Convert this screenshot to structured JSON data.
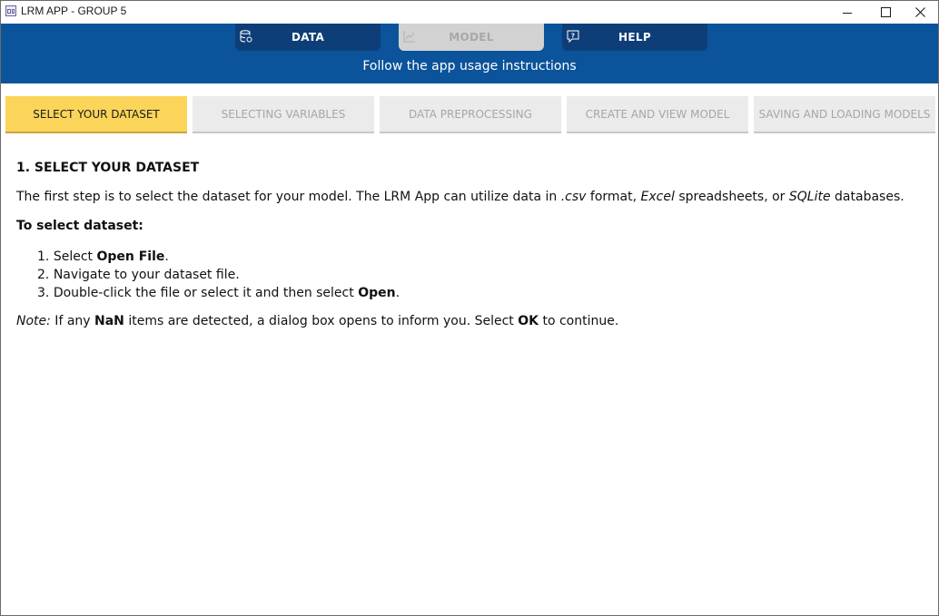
{
  "window": {
    "title": "LRM APP - GROUP 5",
    "controls": [
      "minimize",
      "maximize",
      "close"
    ]
  },
  "nav": {
    "tabs": [
      {
        "label": "DATA",
        "icon": "database-icon",
        "state": "enabled"
      },
      {
        "label": "MODEL",
        "icon": "chart-icon",
        "state": "disabled"
      },
      {
        "label": "HELP",
        "icon": "help-chat-icon",
        "state": "enabled"
      }
    ],
    "subtitle": "Follow the app usage instructions"
  },
  "steps": [
    {
      "label": "SELECT YOUR DATASET",
      "active": true
    },
    {
      "label": "SELECTING VARIABLES",
      "active": false
    },
    {
      "label": "DATA PREPROCESSING",
      "active": false
    },
    {
      "label": "CREATE AND VIEW MODEL",
      "active": false
    },
    {
      "label": "SAVING AND LOADING MODELS",
      "active": false
    }
  ],
  "content": {
    "heading": "1. SELECT YOUR DATASET",
    "intro": {
      "part1": "The first step is to select the dataset for your model. The LRM App can utilize data in ",
      "csv": ".csv",
      "part2": " format, ",
      "excel": "Excel",
      "part3": " spreadsheets, or ",
      "sqlite": "SQLite",
      "part4": " databases."
    },
    "subheading": "To select dataset:",
    "list": [
      {
        "num": "1.",
        "pre": "Select ",
        "bold": "Open File",
        "post": "."
      },
      {
        "num": "2.",
        "pre": "Navigate to your dataset file.",
        "bold": "",
        "post": ""
      },
      {
        "num": "3.",
        "pre": "Double-click the file or select it and then select ",
        "bold": "Open",
        "post": "."
      }
    ],
    "note": {
      "label": "Note:",
      "part1": " If any ",
      "nan": "NaN",
      "part2": " items are detected, a dialog box opens to inform you. Select ",
      "ok": "OK",
      "part3": " to continue."
    }
  },
  "colors": {
    "header_blue": "#0b539a",
    "tab_dark_blue": "#0e3e78",
    "active_step_yellow": "#fbd55a",
    "inactive_step_gray": "#ebebeb"
  }
}
